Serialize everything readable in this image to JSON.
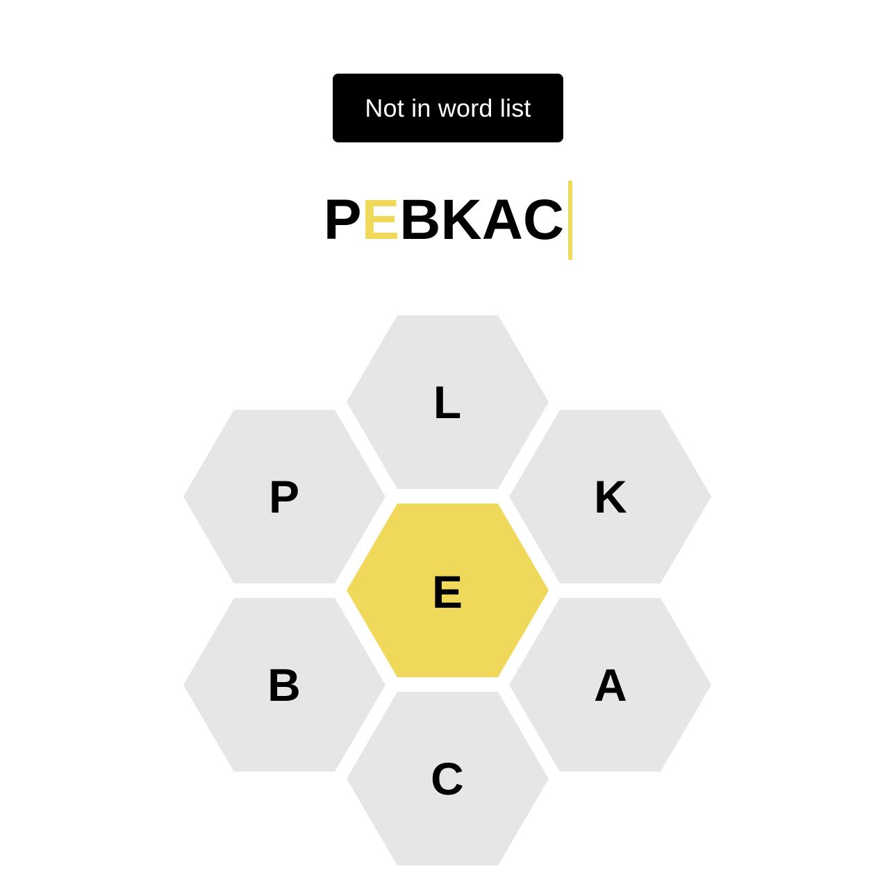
{
  "toast": {
    "message": "Not in word list"
  },
  "input": {
    "letters": [
      {
        "char": "P",
        "is_center": false
      },
      {
        "char": "E",
        "is_center": true
      },
      {
        "char": "B",
        "is_center": false
      },
      {
        "char": "K",
        "is_center": false
      },
      {
        "char": "A",
        "is_center": false
      },
      {
        "char": "C",
        "is_center": false
      }
    ]
  },
  "hive": {
    "center_letter": "E",
    "outer_letters": {
      "top": "L",
      "upper_left": "P",
      "upper_right": "K",
      "lower_left": "B",
      "lower_right": "A",
      "bottom": "C"
    }
  },
  "colors": {
    "center_fill": "#f0d95a",
    "outer_fill": "#e6e6e6",
    "center_letter_in_input": "#f0d95a",
    "cursor": "#f0d95a",
    "toast_background": "#000000",
    "toast_text": "#ffffff"
  }
}
